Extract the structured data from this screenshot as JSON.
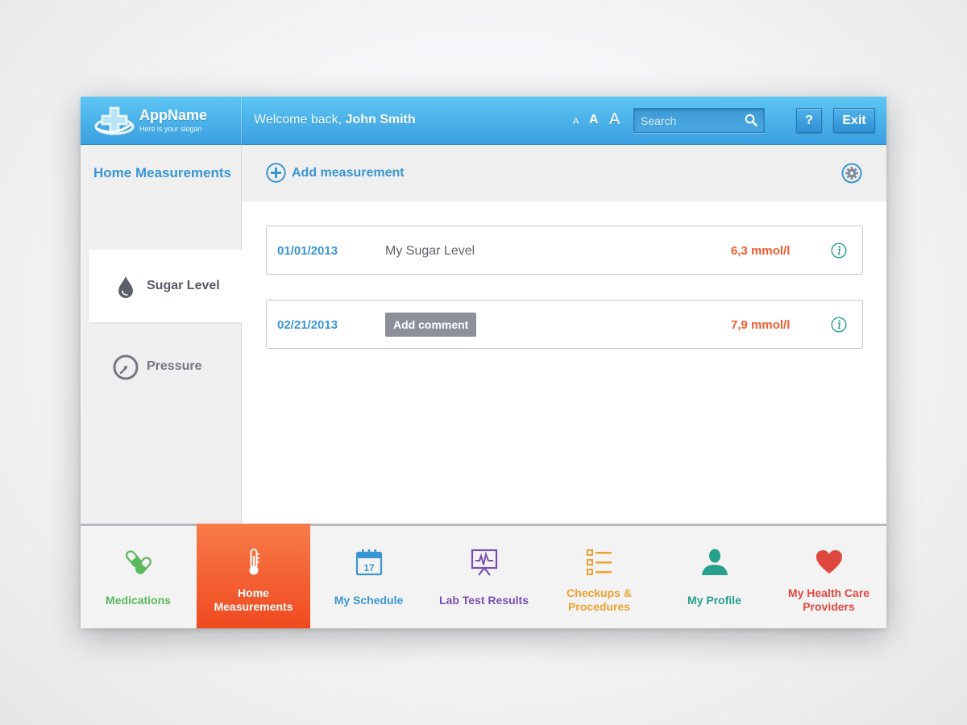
{
  "header": {
    "app_name": "AppName",
    "slogan": "Here is your slogan",
    "welcome_prefix": "Welcome back, ",
    "user_name": "John Smith",
    "font_small": "A",
    "font_medium": "A",
    "font_large": "A",
    "search_placeholder": "Search",
    "help_label": "?",
    "exit_label": "Exit"
  },
  "sidebar": {
    "title": "Home Measurements",
    "items": [
      {
        "label": "Sugar Level",
        "icon": "drop-icon",
        "active": true
      },
      {
        "label": "Pressure",
        "icon": "gauge-icon",
        "active": false
      }
    ]
  },
  "toolbar": {
    "add_label": "Add measurement"
  },
  "records": [
    {
      "date": "01/01/2013",
      "name": "My Sugar Level",
      "value": "6,3 mmol/l"
    },
    {
      "date": "02/21/2013",
      "comment_button": "Add comment",
      "value": "7,9 mmol/l"
    }
  ],
  "bottom_nav": [
    {
      "label": "Medications",
      "icon": "pills-icon",
      "color": "#5cb85c"
    },
    {
      "label": "Home Measurements",
      "icon": "thermometer-icon",
      "color": "#ffffff",
      "active": true
    },
    {
      "label": "My Schedule",
      "icon": "calendar-icon",
      "color": "#3a96d3",
      "calendar_day": "17"
    },
    {
      "label": "Lab Test Results",
      "icon": "chart-board-icon",
      "color": "#7b4fb0"
    },
    {
      "label": "Checkups & Procedures",
      "icon": "checklist-icon",
      "color": "#f0a030"
    },
    {
      "label": "My Profile",
      "icon": "person-icon",
      "color": "#26a08a"
    },
    {
      "label": "My Health Care Providers",
      "icon": "heart-icon",
      "color": "#e0483f"
    }
  ],
  "colors": {
    "accent_blue": "#3a96d3",
    "active_orange": "#f04a20",
    "value_red": "#f15b31"
  }
}
